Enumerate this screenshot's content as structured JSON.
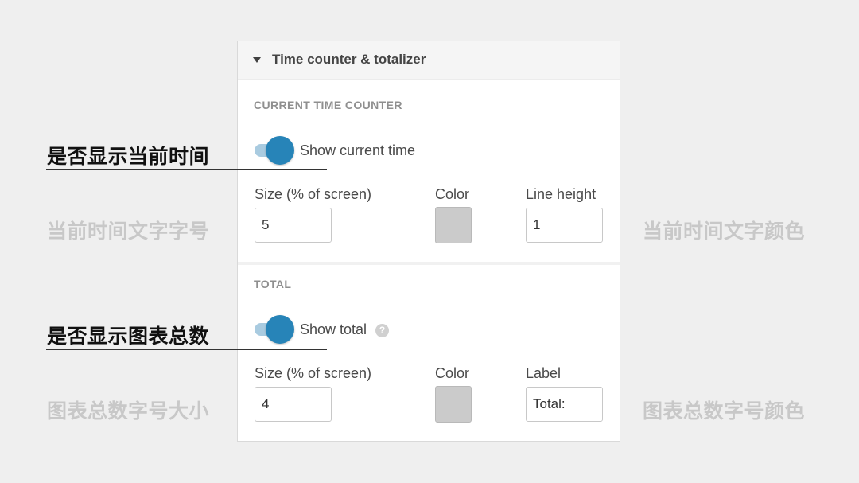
{
  "panel": {
    "title": "Time counter & totalizer",
    "current_time_section": {
      "heading": "CURRENT TIME COUNTER",
      "toggle_label": "Show current time",
      "toggle_on": true,
      "size_label": "Size (% of screen)",
      "size_value": "5",
      "color_label": "Color",
      "color_value": "#cbcbcb",
      "line_height_label": "Line height",
      "line_height_value": "1"
    },
    "total_section": {
      "heading": "TOTAL",
      "toggle_label": "Show total",
      "toggle_on": true,
      "help_icon": "question-mark-icon",
      "help_glyph": "?",
      "size_label": "Size (% of screen)",
      "size_value": "4",
      "color_label": "Color",
      "color_value": "#cbcbcb",
      "label_label": "Label",
      "label_value": "Total:"
    }
  },
  "annotations": {
    "show_current_time": "是否显示当前时间",
    "current_time_font_size": "当前时间文字字号",
    "current_time_font_color": "当前时间文字颜色",
    "show_total": "是否显示图表总数",
    "total_font_size": "图表总数字号大小",
    "total_font_color": "图表总数字号颜色"
  },
  "colors": {
    "accent": "#2784b8",
    "accent_track": "#a9cbe0",
    "background": "#efefef",
    "panel": "#ffffff"
  }
}
